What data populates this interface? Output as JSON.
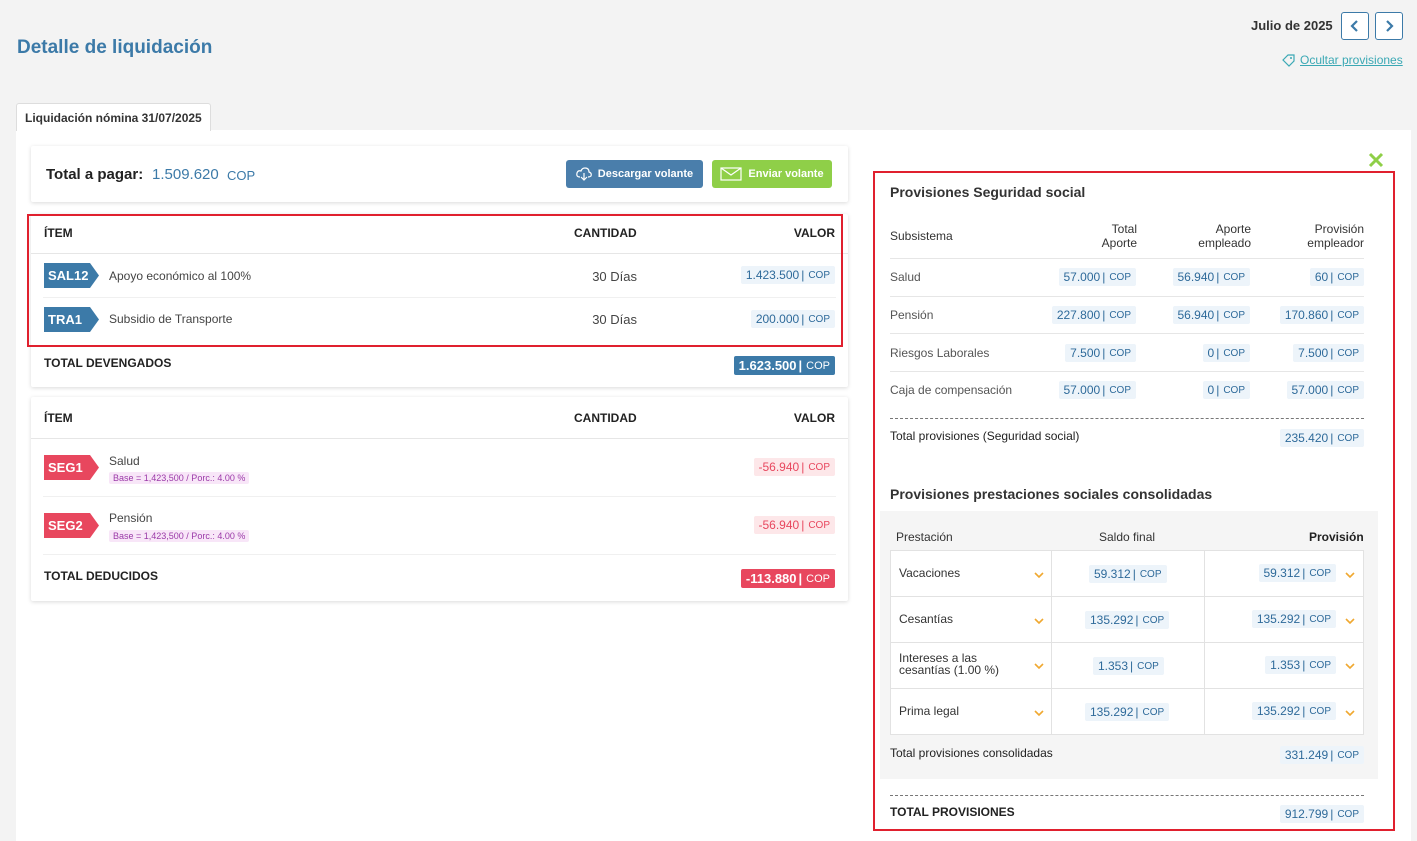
{
  "page": {
    "title": "Detalle de liquidación",
    "month": "Julio de 2025",
    "hide_provisions": "Ocultar provisiones"
  },
  "tab": {
    "label": "Liquidación nómina 31/07/2025"
  },
  "summary": {
    "label": "Total a pagar:",
    "value": "1.509.620",
    "currency": "COP",
    "download_label": "Descargar volante",
    "send_label": "Enviar volante"
  },
  "devengados": {
    "headers": {
      "item": "ÍTEM",
      "qty": "CANTIDAD",
      "value": "VALOR"
    },
    "rows": [
      {
        "code": "SAL12",
        "desc": "Apoyo económico al 100%",
        "qty": "30 Días",
        "value": "1.423.500",
        "cur": "COP"
      },
      {
        "code": "TRA1",
        "desc": "Subsidio de Transporte",
        "qty": "30 Días",
        "value": "200.000",
        "cur": "COP"
      }
    ],
    "total_label": "TOTAL DEVENGADOS",
    "total_value": "1.623.500",
    "total_cur": "COP"
  },
  "deducidos": {
    "headers": {
      "item": "ÍTEM",
      "qty": "CANTIDAD",
      "value": "VALOR"
    },
    "rows": [
      {
        "code": "SEG1",
        "desc": "Salud",
        "base": "Base = 1,423,500 / Porc.: 4.00 %",
        "value": "-56.940",
        "cur": "COP"
      },
      {
        "code": "SEG2",
        "desc": "Pensión",
        "base": "Base = 1,423,500 / Porc.: 4.00 %",
        "value": "-56.940",
        "cur": "COP"
      }
    ],
    "total_label": "TOTAL DEDUCIDOS",
    "total_value": "-113.880",
    "total_cur": "COP"
  },
  "seguridad_social": {
    "title": "Provisiones Seguridad social",
    "headers": {
      "sub": "Subsistema",
      "total": "Total Aporte",
      "empleado": "Aporte empleado",
      "empleador": "Provisión empleador"
    },
    "rows": [
      {
        "name": "Salud",
        "total": "57.000",
        "empleado": "56.940",
        "empleador": "60"
      },
      {
        "name": "Pensión",
        "total": "227.800",
        "empleado": "56.940",
        "empleador": "170.860"
      },
      {
        "name": "Riesgos Laborales",
        "total": "7.500",
        "empleado": "0",
        "empleador": "7.500"
      },
      {
        "name": "Caja de compensación",
        "total": "57.000",
        "empleado": "0",
        "empleador": "57.000"
      }
    ],
    "total_label": "Total provisiones (Seguridad social)",
    "total_value": "235.420",
    "cur": "COP"
  },
  "prestaciones": {
    "title": "Provisiones prestaciones sociales consolidadas",
    "headers": {
      "prest": "Prestación",
      "saldo": "Saldo final",
      "prov": "Provisión"
    },
    "rows": [
      {
        "name": "Vacaciones",
        "saldo": "59.312",
        "prov": "59.312"
      },
      {
        "name": "Cesantías",
        "saldo": "135.292",
        "prov": "135.292"
      },
      {
        "name": "Intereses a las cesantías (1.00 %)",
        "saldo": "1.353",
        "prov": "1.353"
      },
      {
        "name": "Prima legal",
        "saldo": "135.292",
        "prov": "135.292"
      }
    ],
    "total_label": "Total provisiones consolidadas",
    "total_value": "331.249",
    "cur": "COP"
  },
  "grand_total": {
    "label": "TOTAL PROVISIONES",
    "value": "912.799",
    "cur": "COP"
  },
  "colors": {
    "primary": "#3c7aa8",
    "danger": "#e8475e",
    "success": "#8fcf48",
    "highlight": "#e0202e",
    "link": "#3aa8b4"
  }
}
